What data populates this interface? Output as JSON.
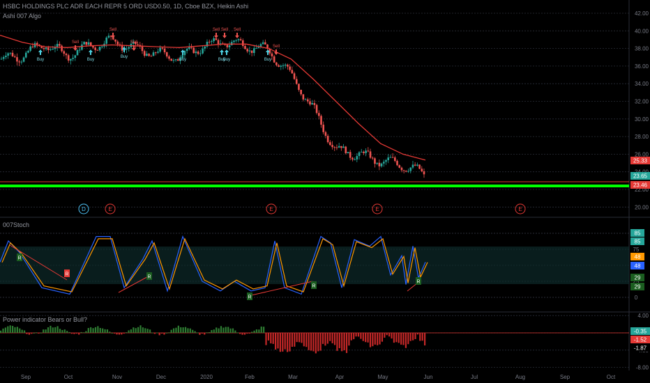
{
  "header": {
    "symbol_line": "HSBC HOLDINGS PLC ADR EACH REPR 5 ORD USD0.50, 1D, Cboe BZX, Heikin Ashi",
    "indicator_1": "Ashi 007 Algo",
    "indicator_2": "007Stoch",
    "indicator_3": "Power indicator Bears or Bull?"
  },
  "price_axis": [
    "42.00",
    "40.00",
    "38.00",
    "36.00",
    "34.00",
    "32.00",
    "30.00",
    "28.00",
    "26.00",
    "24.00",
    "22.00",
    "20.00"
  ],
  "price_badges": {
    "ma": "25.33",
    "close": "23.65",
    "level": "23.46"
  },
  "stoch_axis": [
    "100",
    "75",
    "50",
    "25",
    "0"
  ],
  "stoch_badges": [
    "85",
    "85",
    "48",
    "48",
    "29",
    "29"
  ],
  "power_axis": [
    "4.00",
    "0.00",
    "-4.00",
    "-8.00"
  ],
  "power_badges": [
    "-0.35",
    "-1.52",
    "-1.87"
  ],
  "time_axis": [
    "Sep",
    "Oct",
    "Nov",
    "Dec",
    "2020",
    "Feb",
    "Mar",
    "Apr",
    "May",
    "Jun",
    "Jul",
    "Aug",
    "Sep",
    "Oct"
  ],
  "signals": {
    "buy": "Buy",
    "sell": "Sell",
    "sellsell": "SellSell",
    "buybuy": "BuyBuy",
    "r": "R"
  },
  "events": [
    {
      "label": "D"
    },
    {
      "label": "E"
    },
    {
      "label": "E"
    },
    {
      "label": "E"
    },
    {
      "label": "E"
    }
  ],
  "colors": {
    "bg": "#000000",
    "up": "#26a69a",
    "down": "#ef5350",
    "ma": "#e53935",
    "support": "#00ff00",
    "stoch_k": "#2962ff",
    "stoch_d": "#ff9800"
  },
  "chart_data": {
    "type": "candlestick",
    "x": [
      "2019-08-20",
      "2019-09-01",
      "2019-09-15",
      "2019-10-01",
      "2019-10-15",
      "2019-11-01",
      "2019-11-15",
      "2019-12-01",
      "2019-12-15",
      "2020-01-01",
      "2020-01-15",
      "2020-02-01",
      "2020-02-15",
      "2020-03-01",
      "2020-03-15",
      "2020-04-01",
      "2020-04-15",
      "2020-05-01",
      "2020-05-15",
      "2020-06-01"
    ],
    "close": [
      36.8,
      37.2,
      38.5,
      37.2,
      38.3,
      38.9,
      38.0,
      37.4,
      37.0,
      38.2,
      38.8,
      38.3,
      37.8,
      35.0,
      31.0,
      26.5,
      26.0,
      25.2,
      24.8,
      23.65
    ],
    "ma": [
      39.5,
      38.7,
      38.2,
      38.1,
      38.3,
      38.4,
      38.3,
      38.2,
      38.1,
      38.3,
      38.5,
      38.5,
      38.0,
      36.8,
      34.5,
      32.0,
      29.5,
      27.2,
      26.0,
      25.33
    ],
    "support_level": 23.46,
    "ylim": [
      19.5,
      42.5
    ]
  }
}
